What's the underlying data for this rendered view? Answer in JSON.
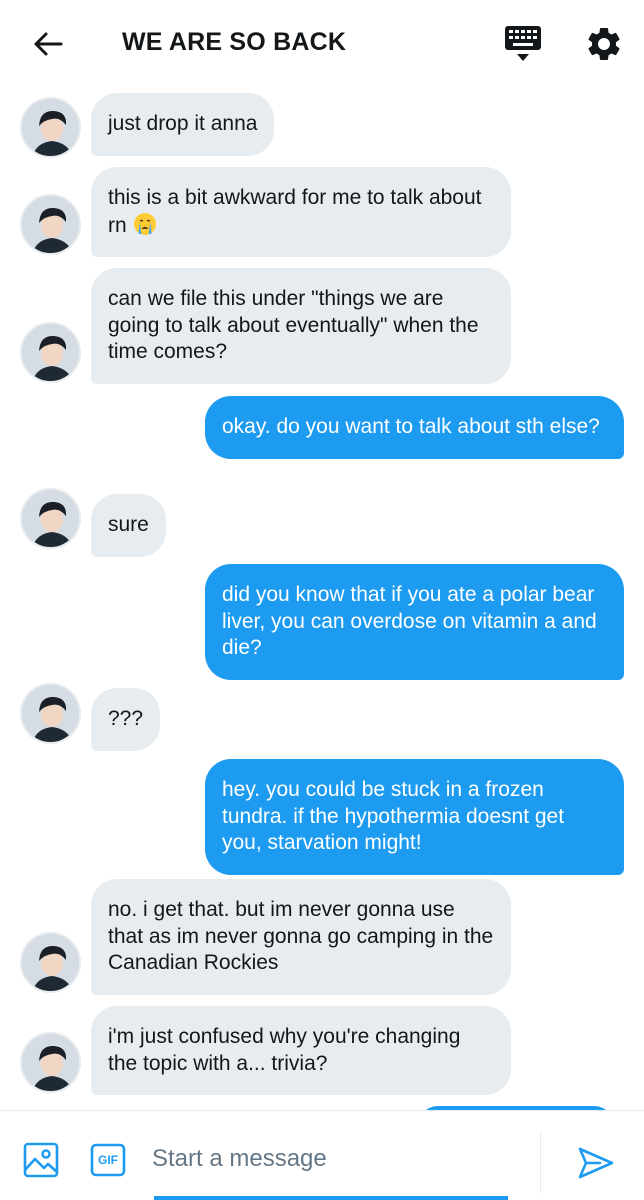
{
  "header": {
    "title": "WE ARE SO BACK",
    "back_icon": "arrow-left-icon",
    "keyboard_icon": "keyboard-icon",
    "settings_icon": "gear-icon"
  },
  "messages": [
    {
      "direction": "in",
      "text": "just drop it anna"
    },
    {
      "direction": "in",
      "text": "this is a bit awkward for me to talk about rn",
      "emoji": "crying-face-emoji"
    },
    {
      "direction": "in",
      "text": "can we file this under \"things we are going to talk about eventually\" when the time comes?"
    },
    {
      "direction": "out",
      "text": "okay. do you want to talk about sth else?"
    },
    {
      "direction": "in",
      "text": "sure"
    },
    {
      "direction": "out",
      "text": "did you know that if you ate a polar bear liver, you can overdose on vitamin a and die?"
    },
    {
      "direction": "in",
      "text": "???"
    },
    {
      "direction": "out",
      "text": "hey. you could be stuck in a frozen tundra. if the hypothermia doesnt get you, starvation might!"
    },
    {
      "direction": "in",
      "text": "no. i get that. but im never gonna use that as im never gonna go camping in the Canadian Rockies"
    },
    {
      "direction": "in",
      "text": "i'm just confused why you're changing the topic with a... trivia?"
    }
  ],
  "composer": {
    "placeholder": "Start a message",
    "value": "",
    "gif_label": "GIF",
    "image_icon": "image-icon",
    "send_icon": "send-icon"
  },
  "colors": {
    "accent": "#1d9bf0",
    "incoming_bubble": "#e6ecf0",
    "text": "#14171a",
    "placeholder": "#657786"
  }
}
